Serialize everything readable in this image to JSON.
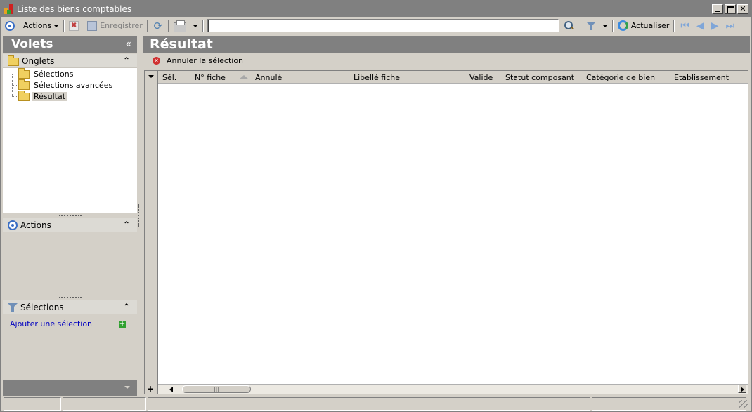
{
  "window": {
    "title": "Liste des biens comptables"
  },
  "toolbar": {
    "actions_label": "Actions",
    "save_label": "Enregistrer",
    "refresh_label": "Actualiser",
    "search_value": ""
  },
  "left": {
    "header": "Volets",
    "onglets": {
      "title": "Onglets",
      "items": [
        "Sélections",
        "Sélections avancées",
        "Résultat"
      ],
      "selected": "Résultat"
    },
    "actions": {
      "title": "Actions"
    },
    "selections": {
      "title": "Sélections",
      "add_link": "Ajouter une sélection"
    }
  },
  "right": {
    "header": "Résultat",
    "cancel_selection": "Annuler la sélection",
    "columns": [
      "Sél.",
      "N° fiche",
      "Annulé",
      "Libellé fiche",
      "Valide",
      "Statut composant",
      "Catégorie de bien",
      "Etablissement"
    ]
  },
  "colors": {
    "header_bg": "#808080",
    "chrome_bg": "#d4d0c8",
    "link": "#0000c0"
  }
}
